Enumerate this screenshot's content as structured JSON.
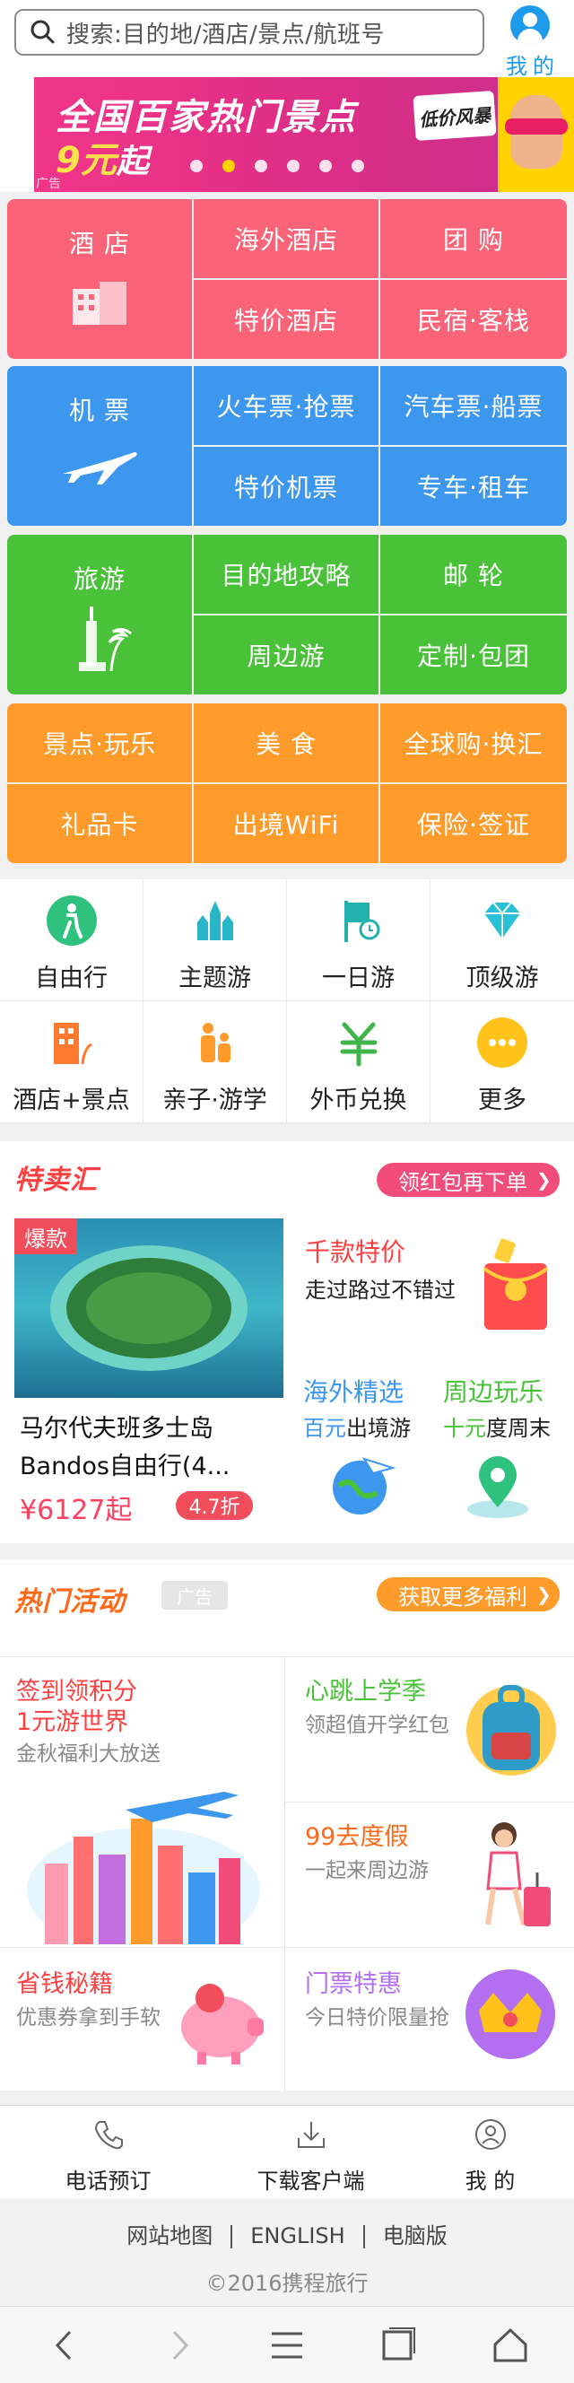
{
  "header": {
    "search_placeholder": "搜索:目的地/酒店/景点/航班号",
    "me_label": "我的"
  },
  "banner": {
    "line1": "全国百家热门景点",
    "price": "9元",
    "price_suffix": "起",
    "badge": "低价风暴",
    "ad_label": "广告",
    "active_dot": 1,
    "dot_count": 6
  },
  "categories": {
    "hotel": {
      "color": "#fb6478",
      "main": "酒 店",
      "items": [
        "海外酒店",
        "团 购",
        "特价酒店",
        "民宿·客栈"
      ]
    },
    "flight": {
      "color": "#3d97ee",
      "main": "机 票",
      "items": [
        "火车票·抢票",
        "汽车票·船票",
        "特价机票",
        "专车·租车"
      ]
    },
    "travel": {
      "color": "#49c23a",
      "main": "旅游",
      "items": [
        "目的地攻略",
        "邮 轮",
        "周边游",
        "定制·包团"
      ]
    },
    "misc": {
      "color": "#ff9b2b",
      "items": [
        "景点·玩乐",
        "美 食",
        "全球购·换汇",
        "礼品卡",
        "出境WiFi",
        "保险·签证"
      ]
    }
  },
  "icon_grid": [
    {
      "label": "自由行",
      "icon": "walker-icon",
      "color": "#2ec27e"
    },
    {
      "label": "主题游",
      "icon": "castle-icon",
      "color": "#29b5c8"
    },
    {
      "label": "一日游",
      "icon": "flag-clock-icon",
      "color": "#22b2ae"
    },
    {
      "label": "顶级游",
      "icon": "diamond-icon",
      "color": "#27c0d6"
    },
    {
      "label": "酒店+景点",
      "icon": "building-icon",
      "color": "#ff7a2f"
    },
    {
      "label": "亲子·游学",
      "icon": "family-icon",
      "color": "#ff9b2b"
    },
    {
      "label": "外币兑换",
      "icon": "currency-icon",
      "color": "#41b54a"
    },
    {
      "label": "更多",
      "icon": "more-icon",
      "color": "#ffc21a"
    }
  ],
  "special": {
    "title": "特卖汇",
    "pill": "领红包再下单",
    "hot_badge": "爆款",
    "product_line1": "马尔代夫班多士岛",
    "product_line2": "Bandos自由行(4...",
    "price": "¥6127起",
    "discount": "4.7折",
    "promo1_title": "千款特价",
    "promo1_sub": "走过路过不错过",
    "promo2_title": "海外精选",
    "promo2_sub_hl": "百元",
    "promo2_sub": "出境游",
    "promo3_title": "周边玩乐",
    "promo3_sub_hl": "十元",
    "promo3_sub": "度周末"
  },
  "activities": {
    "title": "热门活动",
    "ad_label": "广告",
    "pill": "获取更多福利",
    "a1_title1": "签到领积分",
    "a1_title2": "1元游世界",
    "a1_sub": "金秋福利大放送",
    "a2_title": "心跳上学季",
    "a2_sub": "领超值开学红包",
    "a3_title": "99去度假",
    "a3_sub": "一起来周边游",
    "a4_title": "省钱秘籍",
    "a4_sub": "优惠券拿到手软",
    "a5_title": "门票特惠",
    "a5_sub": "今日特价限量抢"
  },
  "footer_nav": [
    {
      "label": "电话预订",
      "icon": "phone-icon"
    },
    {
      "label": "下载客户端",
      "icon": "download-icon"
    },
    {
      "label": "我 的",
      "icon": "user-icon"
    }
  ],
  "footer_links": [
    "网站地图",
    "ENGLISH",
    "电脑版"
  ],
  "copyright": "©2016携程旅行",
  "colors": {
    "brand_blue": "#1e9bea",
    "hotel": "#fb6478",
    "flight": "#3d97ee",
    "travel": "#49c23a",
    "misc": "#ff9b2b"
  }
}
